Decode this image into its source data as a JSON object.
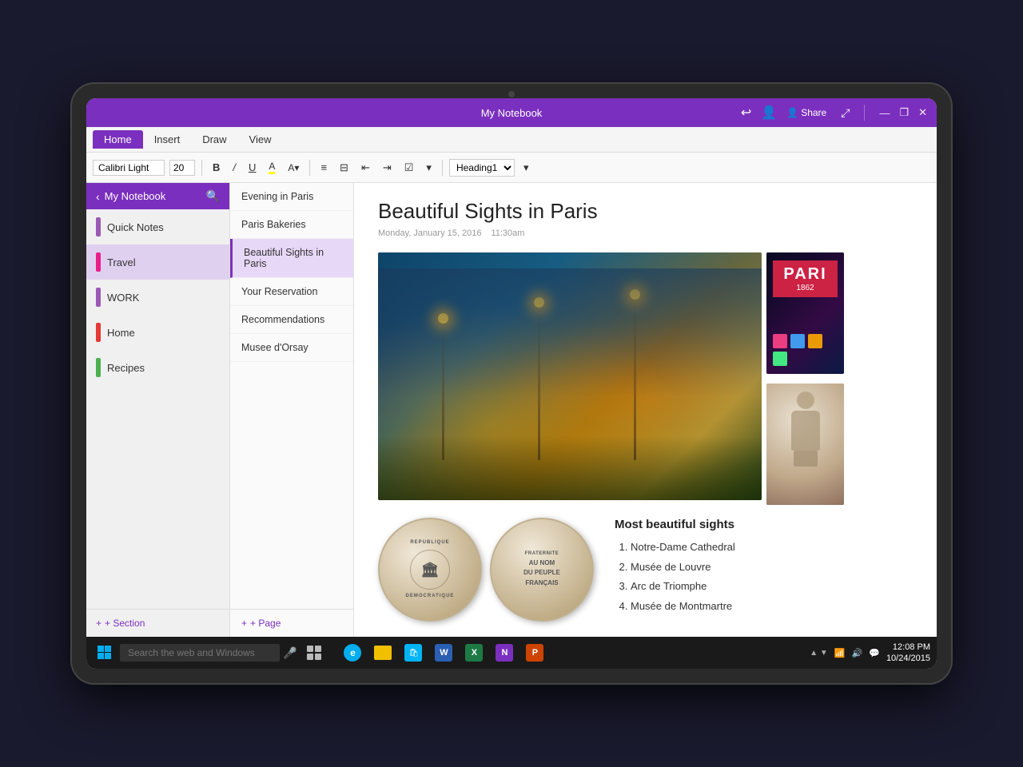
{
  "device": {
    "title": "My Notebook"
  },
  "titlebar": {
    "title": "My Notebook",
    "minimize": "—",
    "restore": "❐",
    "close": "✕",
    "share_label": "Share"
  },
  "menutabs": {
    "tabs": [
      {
        "label": "Home",
        "active": true
      },
      {
        "label": "Insert",
        "active": false
      },
      {
        "label": "Draw",
        "active": false
      },
      {
        "label": "View",
        "active": false
      }
    ]
  },
  "toolbar": {
    "font_name": "Calibri Light",
    "font_size": "20",
    "bold": "B",
    "italic": "/",
    "underline": "U",
    "heading": "Heading1"
  },
  "sections_sidebar": {
    "header": "My Notebook",
    "sections": [
      {
        "label": "Quick Notes",
        "color": "#9b59b6"
      },
      {
        "label": "Travel",
        "color": "#e91e8c",
        "active": true
      },
      {
        "label": "WORK",
        "color": "#9b59b6"
      },
      {
        "label": "Home",
        "color": "#e53935"
      },
      {
        "label": "Recipes",
        "color": "#4caf50"
      }
    ],
    "add_section": "+ Section"
  },
  "pages_sidebar": {
    "pages": [
      {
        "label": "Evening in Paris"
      },
      {
        "label": "Paris Bakeries"
      },
      {
        "label": "Beautiful Sights in Paris",
        "active": true
      },
      {
        "label": "Your Reservation"
      },
      {
        "label": "Recommendations"
      },
      {
        "label": "Musee d'Orsay"
      }
    ],
    "add_page": "+ Page"
  },
  "note": {
    "title": "Beautiful Sights in Paris",
    "date": "Monday, January 15, 2016",
    "time": "11:30am",
    "sights_title": "Most beautiful sights",
    "sights": [
      "Notre-Dame Cathedral",
      "Musée de Louvre",
      "Arc de Triomphe",
      "Musée de Montmartre"
    ],
    "coin1_text": "REPUBLIQUE\nDEMOCRATIQUE",
    "coin2_line1": "FRATERNITE",
    "coin2_line2": "AU NOM",
    "coin2_line3": "DU PEUPLE",
    "coin2_line4": "FRANÇAIS",
    "paris_sign": "PARI",
    "paris_year": "1862"
  },
  "taskbar": {
    "search_placeholder": "Search the web and Windows",
    "time": "12:08 PM",
    "date": "10/24/2015"
  }
}
